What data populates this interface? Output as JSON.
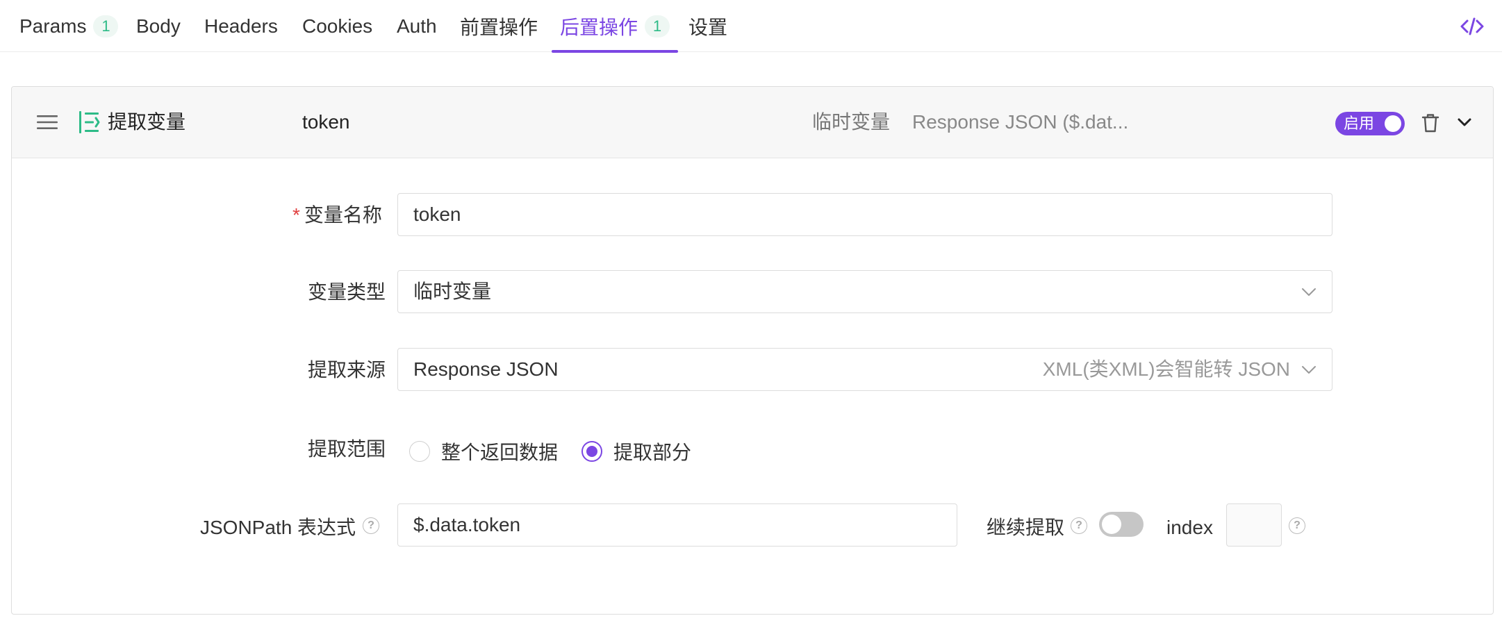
{
  "tabs": [
    {
      "label": "Params",
      "badge": "1"
    },
    {
      "label": "Body"
    },
    {
      "label": "Headers"
    },
    {
      "label": "Cookies"
    },
    {
      "label": "Auth"
    },
    {
      "label": "前置操作"
    },
    {
      "label": "后置操作",
      "badge": "1",
      "active": true
    },
    {
      "label": "设置"
    }
  ],
  "processor": {
    "name": "提取变量",
    "variable": "token",
    "variable_type": "临时变量",
    "source_summary": "Response JSON ($.dat...",
    "enabled_label": "启用",
    "enabled": true
  },
  "form": {
    "var_name": {
      "label": "变量名称",
      "required_mark": "*",
      "value": "token"
    },
    "var_type": {
      "label": "变量类型",
      "value": "临时变量"
    },
    "source": {
      "label": "提取来源",
      "value": "Response JSON",
      "hint": "XML(类XML)会智能转 JSON"
    },
    "scope": {
      "label": "提取范围",
      "options": [
        "整个返回数据",
        "提取部分"
      ],
      "selected": "提取部分"
    },
    "jsonpath": {
      "label": "JSONPath 表达式",
      "value": "$.data.token"
    },
    "continue_extract": {
      "label": "继续提取",
      "enabled": false
    },
    "index": {
      "label": "index",
      "value": ""
    }
  },
  "icons": {
    "code": "code-icon",
    "drag": "hamburger-icon",
    "extract": "extract-variable-icon",
    "delete": "trash-icon",
    "collapse": "chevron-down-icon",
    "dropdown": "chevron-down-icon",
    "help": "question-icon",
    "help_glyph": "?"
  },
  "colors": {
    "accent": "#7b46e3",
    "badge_text": "#2dbb87",
    "badge_bg": "#eef7f3",
    "required": "#e03e3e",
    "extract_icon": "#2dbb87"
  }
}
